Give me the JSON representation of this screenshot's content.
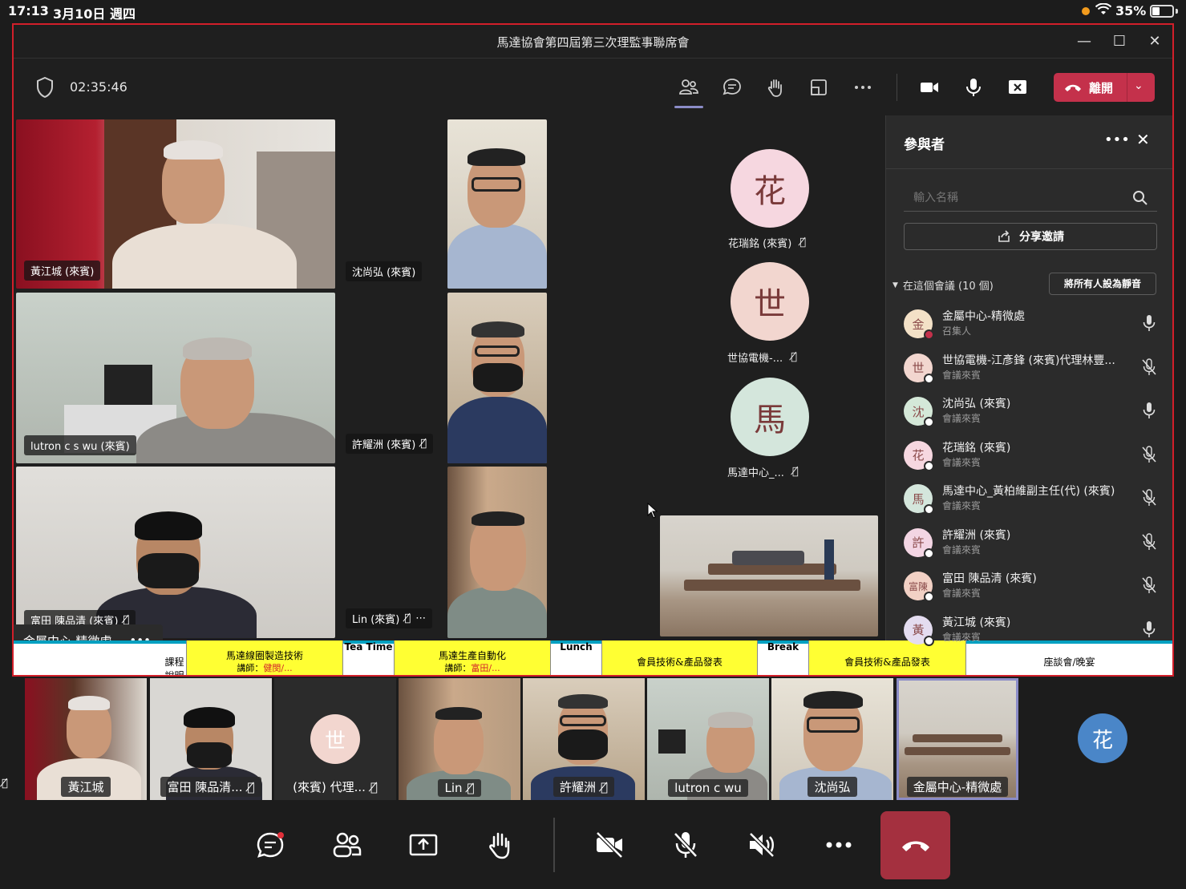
{
  "status": {
    "time": "17:13",
    "date": "3月10日 週四",
    "battery": "35%"
  },
  "window": {
    "title": "馬達協會第四屆第三次理監事聯席會",
    "elapsed": "02:35:46",
    "leave_label": "離開"
  },
  "share_tiles": {
    "t1": "黃江城 (來賓)",
    "t2": "沈尚弘 (來賓)",
    "t3": "lutron c s wu (來賓)",
    "t4": "許耀洲 (來賓)",
    "t5": "富田 陳品清 (來賓)",
    "t6": "Lin (來賓)"
  },
  "avatars": [
    {
      "char": "花",
      "label": "花瑞銘 (來賓)"
    },
    {
      "char": "世",
      "label": "世協電機-..."
    },
    {
      "char": "馬",
      "label": "馬達中心_..."
    }
  ],
  "presenter_chip": "金屬中心-精微處",
  "schedule": {
    "c0": "課程說明",
    "c1a": "馬達線圈製造技術",
    "c1b_pre": "講師：",
    "c1b_name": "健閔/...",
    "c2": "Tea Time",
    "c3a": "馬達生產自動化",
    "c3b_pre": "講師：",
    "c3b_name": "富田/...",
    "c4": "Lunch",
    "c5": "會員技術&產品發表",
    "c6": "Break",
    "c7": "會員技術&產品發表",
    "c8": "座談會/晚宴"
  },
  "panel": {
    "title": "參與者",
    "search_placeholder": "輸入名稱",
    "share_invite": "分享邀請",
    "group": "在這個會議 (10 個)",
    "mute_all": "將所有人設為靜音",
    "participants": [
      {
        "av": "金",
        "name": "金屬中心-精微處",
        "role": "召集人",
        "color": "#f3e1c7"
      },
      {
        "av": "世",
        "name": "世協電機-江彥鋒 (來賓)代理林豐...",
        "role": "會議來賓",
        "color": "#f2d6cf"
      },
      {
        "av": "沈",
        "name": "沈尚弘 (來賓)",
        "role": "會議來賓",
        "color": "#d4e8d8"
      },
      {
        "av": "花",
        "name": "花瑞銘 (來賓)",
        "role": "會議來賓",
        "color": "#f6d7e0"
      },
      {
        "av": "馬",
        "name": "馬達中心_黃柏維副主任(代) (來賓)",
        "role": "會議來賓",
        "color": "#d4e6dc"
      },
      {
        "av": "許",
        "name": "許耀洲 (來賓)",
        "role": "會議來賓",
        "color": "#f3d5e3"
      },
      {
        "av": "富陳",
        "name": "富田 陳品清 (來賓)",
        "role": "會議來賓",
        "color": "#f2d1c5"
      },
      {
        "av": "黃",
        "name": "黃江城 (來賓)",
        "role": "會議來賓",
        "color": "#e4dcf0"
      }
    ]
  },
  "film": [
    {
      "name": "黃江城"
    },
    {
      "name": "富田 陳品清..."
    },
    {
      "name": "(來賓) 代理..."
    },
    {
      "name": "Lin"
    },
    {
      "name": "許耀洲"
    },
    {
      "name": "lutron c wu"
    },
    {
      "name": "沈尚弘"
    },
    {
      "name": "金屬中心-精微處"
    }
  ],
  "film_avatar": {
    "char": "花"
  },
  "film_avatar2": {
    "char": "世"
  }
}
